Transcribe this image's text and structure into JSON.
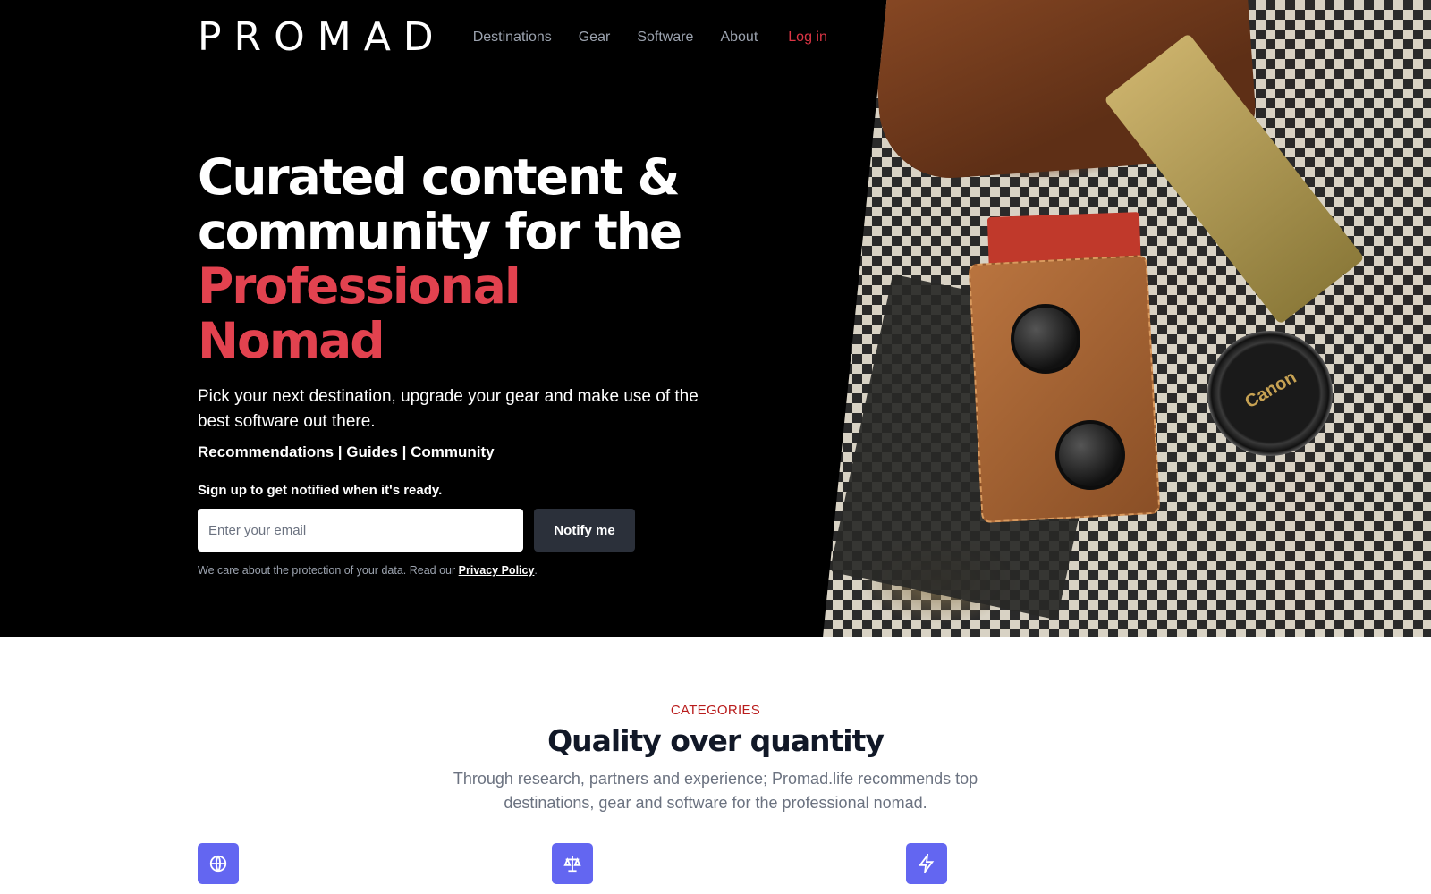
{
  "header": {
    "logo": "PROMAD",
    "nav": [
      "Destinations",
      "Gear",
      "Software",
      "About"
    ],
    "login": "Log in"
  },
  "hero": {
    "headline_line1": "Curated content &",
    "headline_line2": "community for the",
    "headline_accent": "Professional Nomad",
    "subtitle": "Pick your next destination, upgrade your gear and make use of the best software out there.",
    "features": "Recommendations | Guides | Community",
    "signup_label": "Sign up to get notified when it's ready.",
    "email_placeholder": "Enter your email",
    "button_label": "Notify me",
    "privacy_text": "We care about the protection of your data. Read our",
    "privacy_link": "Privacy Policy",
    "privacy_end": ".",
    "photo_lens_text": "Canon"
  },
  "categories": {
    "eyebrow": "CATEGORIES",
    "title": "Quality over quantity",
    "description": "Through research, partners and experience; Promad.life recommends top destinations, gear and software for the professional nomad.",
    "icons": [
      "globe-icon",
      "scale-icon",
      "lightning-icon"
    ]
  },
  "colors": {
    "accent": "#e2424f",
    "eyebrow": "#b91c1c",
    "icon_bg": "#6366f1",
    "button_bg": "#2b303a"
  }
}
